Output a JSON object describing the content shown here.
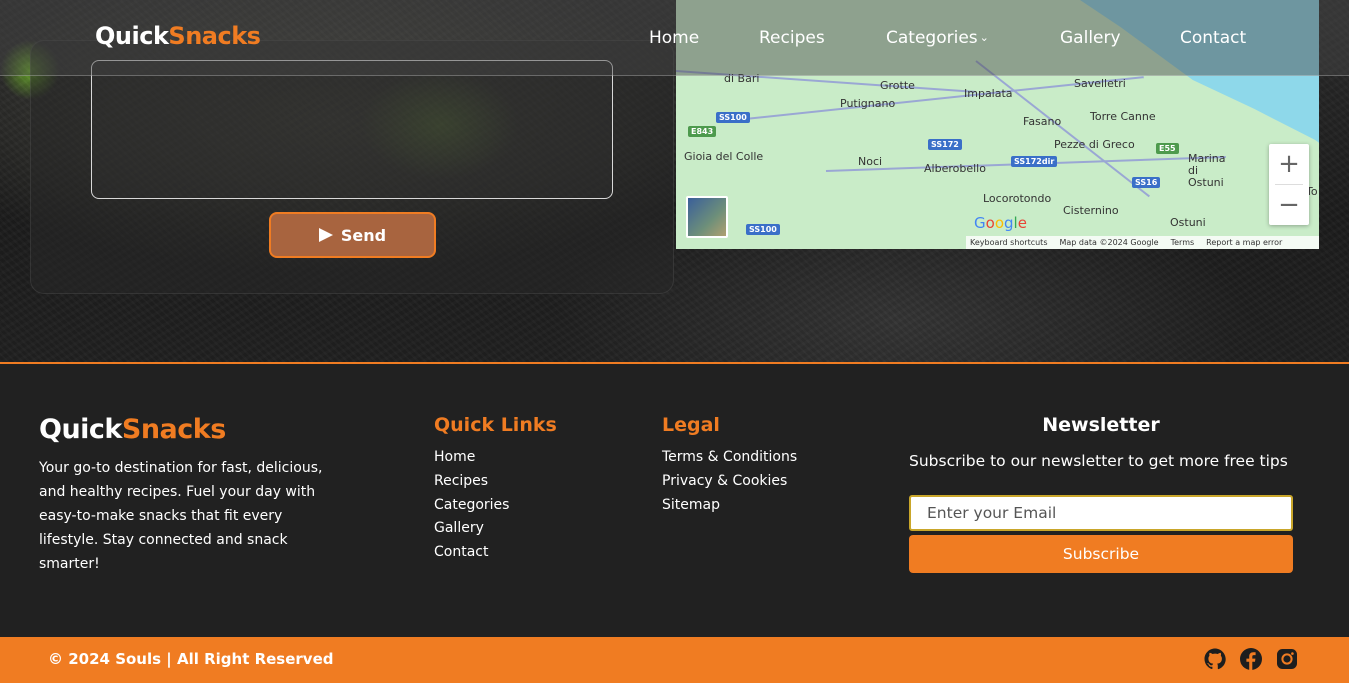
{
  "brand": {
    "part1": "Quick",
    "part2": "Snacks"
  },
  "nav": {
    "items": [
      {
        "label": "Home"
      },
      {
        "label": "Recipes"
      },
      {
        "label": "Categories"
      },
      {
        "label": "Gallery"
      },
      {
        "label": "Contact"
      }
    ]
  },
  "form": {
    "send_label": "Send",
    "send_icon": "paper-plane-icon"
  },
  "map": {
    "towns": [
      "di Bari",
      "Grotte",
      "Impalata",
      "Savelletri",
      "Putignano",
      "Torre Canne",
      "Fasano",
      "Pezze di Greco",
      "Gioia del Colle",
      "Noci",
      "Alberobello",
      "Marina di Ostuni",
      "Locorotondo",
      "Cisternino",
      "Ostuni",
      "To"
    ],
    "shields": [
      "SS100",
      "E843",
      "SS172",
      "SS172dir",
      "E55",
      "SS16",
      "SS100"
    ],
    "zoom_in": "+",
    "zoom_out": "−",
    "google": "Google",
    "footer": {
      "shortcuts": "Keyboard shortcuts",
      "data": "Map data ©2024 Google",
      "terms": "Terms",
      "report": "Report a map error"
    }
  },
  "footer": {
    "description": "Your go-to destination for fast, delicious, and healthy recipes. Fuel your day with easy-to-make snacks that fit every lifestyle. Stay connected and snack smarter!",
    "quick_links": {
      "heading": "Quick Links",
      "items": [
        "Home",
        "Recipes",
        "Categories",
        "Gallery",
        "Contact"
      ]
    },
    "legal": {
      "heading": "Legal",
      "items": [
        "Terms & Conditions",
        "Privacy & Cookies",
        "Sitemap"
      ]
    },
    "newsletter": {
      "heading": "Newsletter",
      "text": "Subscribe to our newsletter to get more free tips",
      "placeholder": "Enter your Email",
      "button": "Subscribe"
    }
  },
  "bottom": {
    "copyright": "© 2024 Souls | All Right Reserved",
    "social": [
      "github-icon",
      "facebook-icon",
      "instagram-icon"
    ]
  },
  "colors": {
    "accent": "#f07c22",
    "footer_bg": "#212121",
    "send_bg": "#a8643f"
  }
}
